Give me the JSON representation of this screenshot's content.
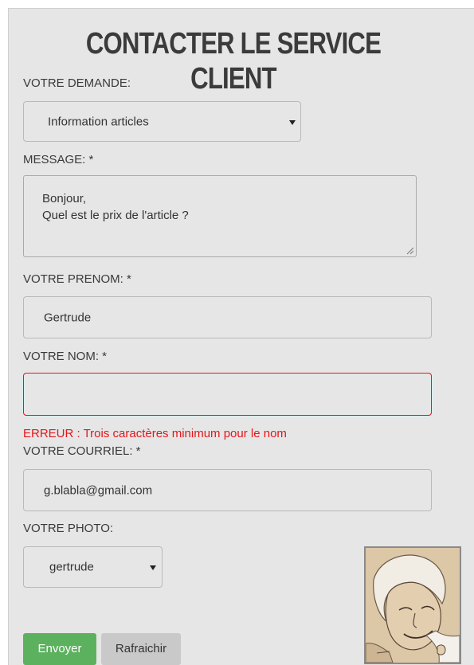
{
  "form": {
    "title": "CONTACTER LE SERVICE CLIENT",
    "request_label": "VOTRE DEMANDE:",
    "request_value": "Information articles",
    "message_label": "MESSAGE: *",
    "message_lines": [
      "Bonjour,",
      "Quel est le prix de l'article ?"
    ],
    "firstname_label": "VOTRE PRENOM: *",
    "firstname_value": "Gertrude",
    "lastname_label": "VOTRE NOM: *",
    "lastname_value": "",
    "error_text": "ERREUR : Trois caractères minimum pour le nom",
    "email_label": "VOTRE COURRIEL: *",
    "email_value": "g.blabla@gmail.com",
    "photo_label": "VOTRE PHOTO:",
    "photo_value": "gertrude",
    "send_label": "Envoyer",
    "refresh_label": "Rafraichir"
  },
  "colors": {
    "panel_bg": "#e6e6e6",
    "error": "#e4161b",
    "send_button": "#5cb15f",
    "refresh_button": "#c9c9c9"
  },
  "icons": {
    "select_caret": "chevron-down-icon",
    "textarea_resize": "resize-handle-icon"
  }
}
